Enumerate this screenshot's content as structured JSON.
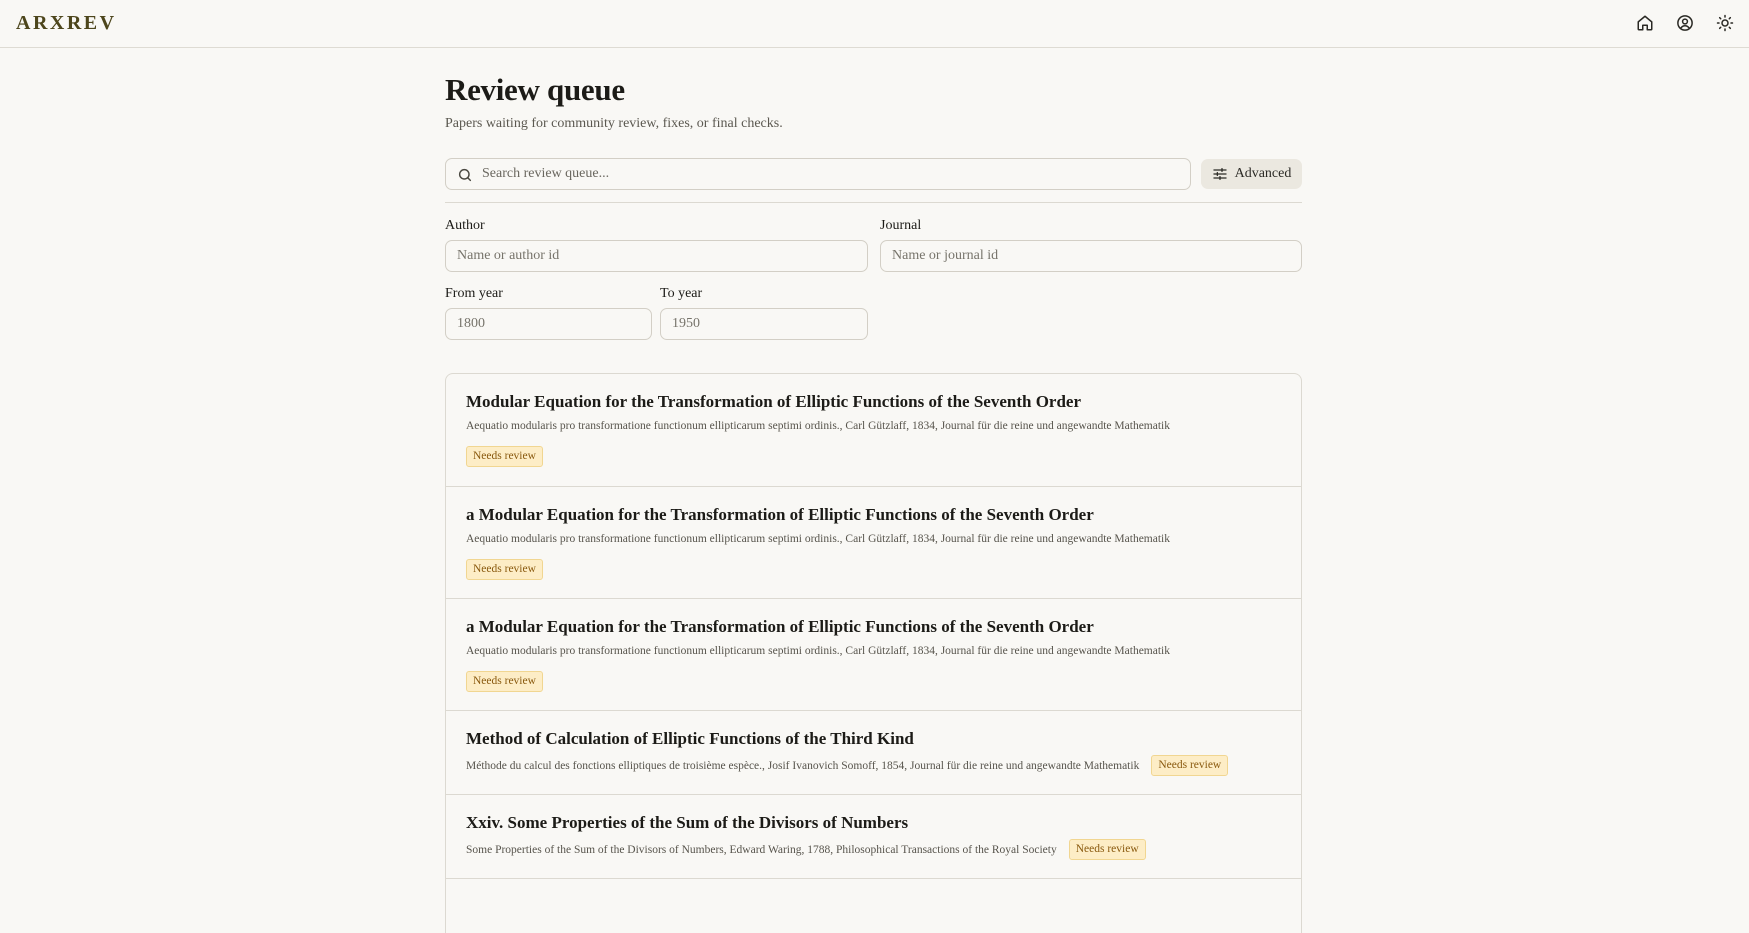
{
  "app": {
    "logo": "ARXREV"
  },
  "header": {
    "icons": [
      "home-icon",
      "user-circle-icon",
      "sun-icon"
    ]
  },
  "page": {
    "title": "Review queue",
    "subtitle": "Papers waiting for community review, fixes, or final checks."
  },
  "search": {
    "placeholder": "Search review queue...",
    "value": ""
  },
  "advanced": {
    "label": "Advanced"
  },
  "filters": {
    "author": {
      "label": "Author",
      "placeholder": "Name or author id"
    },
    "journal": {
      "label": "Journal",
      "placeholder": "Name or journal id"
    },
    "from_year": {
      "label": "From year",
      "placeholder": "1800"
    },
    "to_year": {
      "label": "To year",
      "placeholder": "1950"
    }
  },
  "results": [
    {
      "title": "Modular Equation for the Transformation of Elliptic Functions of the Seventh Order",
      "meta": "Aequatio modularis pro transformatione functionum ellipticarum septimi ordinis., Carl Gützlaff, 1834, Journal für die reine und angewandte Mathematik",
      "badge": "Needs review"
    },
    {
      "title": "a Modular Equation for the Transformation of Elliptic Functions of the Seventh Order",
      "meta": "Aequatio modularis pro transformatione functionum ellipticarum septimi ordinis., Carl Gützlaff, 1834, Journal für die reine und angewandte Mathematik",
      "badge": "Needs review"
    },
    {
      "title": "a Modular Equation for the Transformation of Elliptic Functions of the Seventh Order",
      "meta": "Aequatio modularis pro transformatione functionum ellipticarum septimi ordinis., Carl Gützlaff, 1834, Journal für die reine und angewandte Mathematik",
      "badge": "Needs review"
    },
    {
      "title": "Method of Calculation of Elliptic Functions of the Third Kind",
      "meta": "Méthode du calcul des fonctions elliptiques de troisième espèce., Josif Ivanovich Somoff, 1854, Journal für die reine und angewandte Mathematik",
      "badge": "Needs review"
    },
    {
      "title": "Xxiv. Some Properties of the Sum of the Divisors of Numbers",
      "meta": "Some Properties of the Sum of the Divisors of Numbers, Edward Waring, 1788, Philosophical Transactions of the Royal Society",
      "badge": "Needs review"
    }
  ]
}
